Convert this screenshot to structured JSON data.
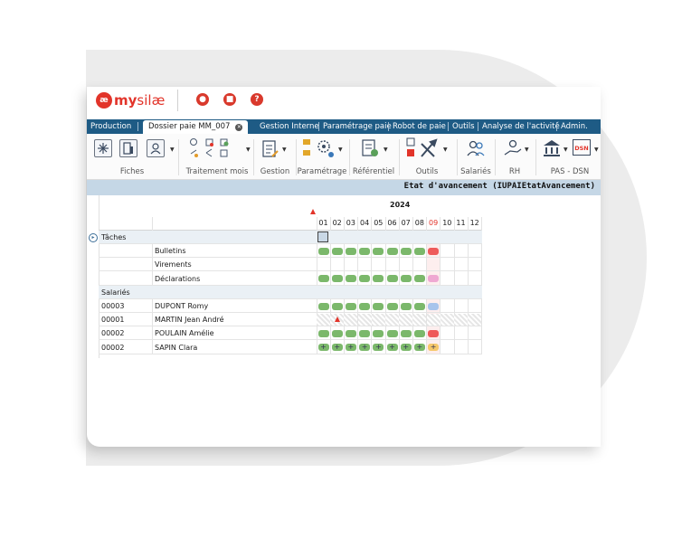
{
  "app": {
    "logo_mark": "æ",
    "logo_my": "my",
    "logo_silae": "silæ",
    "title_buttons": [
      {
        "name": "chat-icon",
        "glyph": "●",
        "color": "#d9392c"
      },
      {
        "name": "document-icon",
        "glyph": "■",
        "color": "#d9392c"
      },
      {
        "name": "help-icon",
        "glyph": "?",
        "color": "#d9392c"
      }
    ]
  },
  "tabs": {
    "production": "Production",
    "active": "Dossier paie MM_007",
    "gestion_interne": "Gestion Interne",
    "parametrage_paie": "Paramétrage paie",
    "robot": "Robot de paie",
    "outils": "Outils",
    "analyse": "Analyse de l'activité",
    "admin": "Admin."
  },
  "ribbon": {
    "fiches": "Fiches",
    "traitement": "Traitement mois",
    "gestion": "Gestion",
    "parametrage": "Paramétrage",
    "referentiel": "Référentiel",
    "outils": "Outils",
    "salaries": "Salariés",
    "rh": "RH",
    "pas_dsn": "PAS - DSN",
    "dsn_icon_text": "DSN"
  },
  "view_title": "Etat d'avancement (IUPAIEtatAvancement)",
  "year": "2024",
  "months": [
    "01",
    "02",
    "03",
    "04",
    "05",
    "06",
    "07",
    "08",
    "09",
    "10",
    "11",
    "12"
  ],
  "current_month": "09",
  "colors": {
    "done": "#7bb86b",
    "error": "#ee5a5a",
    "pending_pink": "#efa8d2",
    "pending_blue": "#a8c4ec",
    "warning_orange": "#f6c86b",
    "tab_blue": "#1e5b85",
    "title_band": "#c5d7e6"
  },
  "sections": {
    "taches": "Tâches",
    "salaries": "Salariés"
  },
  "task_rows": [
    {
      "label": "Bulletins",
      "statuses": [
        "done",
        "done",
        "done",
        "done",
        "done",
        "done",
        "done",
        "done",
        "error",
        "",
        "",
        ""
      ]
    },
    {
      "label": "Virements",
      "statuses": [
        "",
        "",
        "",
        "",
        "",
        "",
        "",
        "",
        "",
        "",
        "",
        ""
      ]
    },
    {
      "label": "Déclarations",
      "statuses": [
        "done",
        "done",
        "done",
        "done",
        "done",
        "done",
        "done",
        "done",
        "pending_pink",
        "",
        "",
        ""
      ]
    }
  ],
  "employee_rows": [
    {
      "code": "00003",
      "name": "DUPONT Romy",
      "statuses": [
        "done",
        "done",
        "done",
        "done",
        "done",
        "done",
        "done",
        "done",
        "pending_blue",
        "",
        "",
        ""
      ]
    },
    {
      "code": "00001",
      "name": "MARTIN Jean André",
      "statuses": [
        "hatch",
        "warn",
        "hatch",
        "hatch",
        "hatch",
        "hatch",
        "hatch",
        "hatch",
        "hatch",
        "hatch",
        "hatch",
        "hatch"
      ]
    },
    {
      "code": "00002",
      "name": "POULAIN Amélie",
      "statuses": [
        "done",
        "done",
        "done",
        "done",
        "done",
        "done",
        "done",
        "done",
        "error",
        "",
        "",
        ""
      ]
    },
    {
      "code": "00002",
      "name": "SAPIN Clara",
      "statuses": [
        "done+",
        "done+",
        "done+",
        "done+",
        "done+",
        "done+",
        "done+",
        "done+",
        "warning_orange+",
        "",
        "",
        ""
      ]
    }
  ]
}
